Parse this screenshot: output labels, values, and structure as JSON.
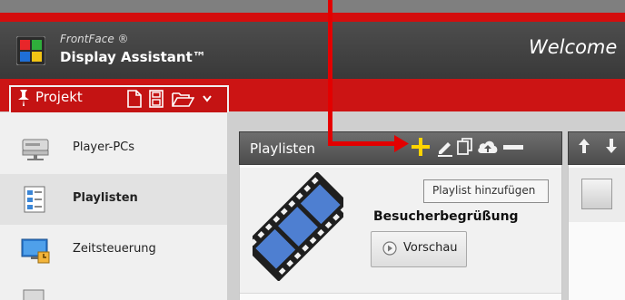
{
  "app": {
    "brand_small": "FrontFace ®",
    "brand_big": "Display Assistant™",
    "welcome": "Welcome"
  },
  "toolbar": {
    "projekt_label": "Projekt",
    "icons": [
      "pin-icon",
      "new-file-icon",
      "save-icon",
      "open-folder-icon",
      "chevron-down-icon"
    ]
  },
  "sidebar": {
    "items": [
      {
        "label": "Player-PCs",
        "icon": "player-pc-icon",
        "selected": false
      },
      {
        "label": "Playlisten",
        "icon": "playlist-icon",
        "selected": true
      },
      {
        "label": "Zeitsteuerung",
        "icon": "schedule-icon",
        "selected": false
      }
    ]
  },
  "playlists_panel": {
    "title": "Playlisten",
    "tools": [
      "add-icon",
      "edit-icon",
      "copy-icon",
      "upload-icon",
      "remove-icon"
    ],
    "tooltip": "Playlist hinzufügen",
    "item": {
      "title": "Besucherbegrüßung",
      "preview_label": "Vorschau"
    }
  },
  "colors": {
    "accent_red": "#cc1414",
    "title_bar": "#434343",
    "annotation": "#e30000",
    "add_icon": "#ffd400"
  }
}
